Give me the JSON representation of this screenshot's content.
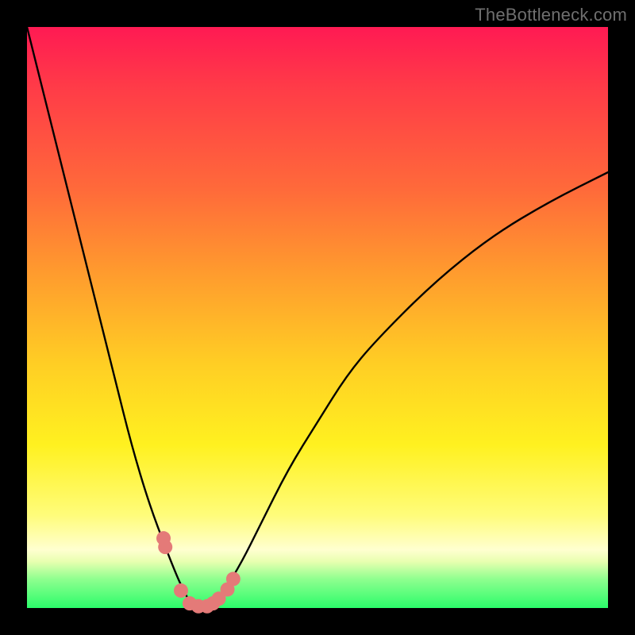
{
  "watermark": "TheBottleneck.com",
  "chart_data": {
    "type": "line",
    "title": "",
    "xlabel": "",
    "ylabel": "",
    "xlim": [
      0,
      100
    ],
    "ylim": [
      0,
      100
    ],
    "series": [
      {
        "name": "bottleneck-curve",
        "x": [
          0,
          5,
          10,
          15,
          18,
          21,
          24,
          26,
          27,
          28,
          29,
          30,
          31,
          32,
          34,
          37,
          40,
          45,
          50,
          55,
          60,
          70,
          80,
          90,
          100
        ],
        "values": [
          100,
          80,
          60,
          40,
          28,
          18,
          10,
          5,
          3,
          1,
          0,
          0,
          0,
          1,
          3,
          8,
          14,
          24,
          32,
          40,
          46,
          56,
          64,
          70,
          75
        ]
      }
    ],
    "markers": {
      "name": "highlight-dots",
      "x": [
        23.5,
        23.8,
        26.5,
        28.0,
        29.5,
        31.0,
        32.0,
        33.0,
        34.5,
        35.5
      ],
      "values": [
        12.0,
        10.5,
        3.0,
        0.8,
        0.3,
        0.3,
        0.8,
        1.6,
        3.2,
        5.0
      ]
    },
    "background_gradient": {
      "top": "#ff1a53",
      "mid": "#fff120",
      "bottom": "#2bfc6a"
    }
  }
}
